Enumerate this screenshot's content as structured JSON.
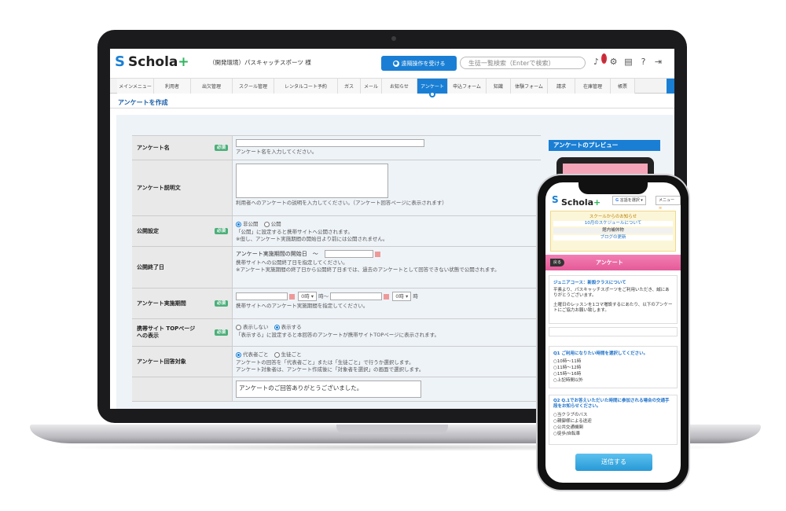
{
  "app": {
    "logo_text": "Schola",
    "logo_plus": "+",
    "school_name": "（開発環境）パスキャッチスポーツ 様",
    "remote_button": "遠隔操作を受ける",
    "search_placeholder": "生徒一覧検索（Enterで検索）",
    "notification_count": "1"
  },
  "tabs": [
    "メインメニュー",
    "利用者",
    "出欠管理",
    "スクール管理",
    "レンタルコート予約",
    "ガス",
    "メール",
    "お知らせ",
    "アンケート",
    "申込フォーム",
    "知識",
    "体験フォーム",
    "請求",
    "在庫管理",
    "帳票"
  ],
  "active_tab": "アンケート",
  "page_title": "アンケートを作成",
  "form": {
    "required": "必須",
    "name": {
      "label": "アンケート名",
      "hint": "アンケート名を入力してください。"
    },
    "description": {
      "label": "アンケート説明文",
      "hint": "利用者へのアンケートの説明を入力してください。（アンケート回答ページに表示されます）"
    },
    "publish": {
      "label": "公開設定",
      "opt_private": "非公開",
      "opt_public": "公開",
      "hint1": "「公開」に設定すると携帯サイトへ公開されます。",
      "hint2": "※但し、アンケート実施期間の開始日より前には公開されません。"
    },
    "publish_end": {
      "label": "公開終了日",
      "text": "アンケート実施期間の開始日　～",
      "hint1": "携帯サイトへの公開終了日を指定してください。",
      "hint2": "※アンケート実施期間の終了日から公開終了日までは、過去のアンケートとして回答できない状態で公開されます。"
    },
    "period": {
      "label": "アンケート実施期間",
      "hour": "0時",
      "hour_label": "時～",
      "end_hour": "0時",
      "end_label": "時",
      "hint": "携帯サイトへのアンケート実施期間を指定してください。"
    },
    "top_display": {
      "label": "携帯サイト TOPページへの表示",
      "opt_hide": "表示しない",
      "opt_show": "表示する",
      "hint": "「表示する」に設定すると本回答のアンケートが携帯サイトTOPページに表示されます。"
    },
    "target": {
      "label": "アンケート回答対象",
      "opt_rep": "代表者ごと",
      "opt_student": "生徒ごと",
      "hint1": "アンケートの回答を「代表者ごと」または「生徒ごと」で行うか選択します。",
      "hint2": "アンケート対象者は、アンケート作成後に「対象者を選択」の画面で選択します。"
    },
    "thanks": {
      "text": "アンケートのご回答ありがとうございました。"
    }
  },
  "preview": {
    "title": "アンケートのプレビュー"
  },
  "phone": {
    "lang_button": "言語を選択",
    "menu_button": "メニュー",
    "news_title": "スクールからのお知らせ",
    "news_items": [
      "10月のスケジュールについて",
      "館内補休物",
      "ブログの更新"
    ],
    "back": "戻る",
    "band_title": "アンケート",
    "intro_title": "ジュニアコース：新設クラスについて",
    "intro_1": "平素より、パスキャッチスポーツをご利用いただき、誠にありがとうございます。",
    "intro_2": "土曜日のレッスンを1コマ増設するにあたり、以下のアンケートにご協力お願い致します。",
    "q1": "Q1 ご利用になりたい時間を選択してください。",
    "q1_options": [
      "10時～11時",
      "11時～12時",
      "15時～16時",
      "上記時間以外"
    ],
    "q2": "Q2 Q.1でお答えいただいた時間に参加される場合の交通手段をお知らせください。",
    "q2_options": [
      "当クラブのバス",
      "親御様による送迎",
      "公共交通機関",
      "徒歩/自転車"
    ],
    "send": "送信する"
  }
}
